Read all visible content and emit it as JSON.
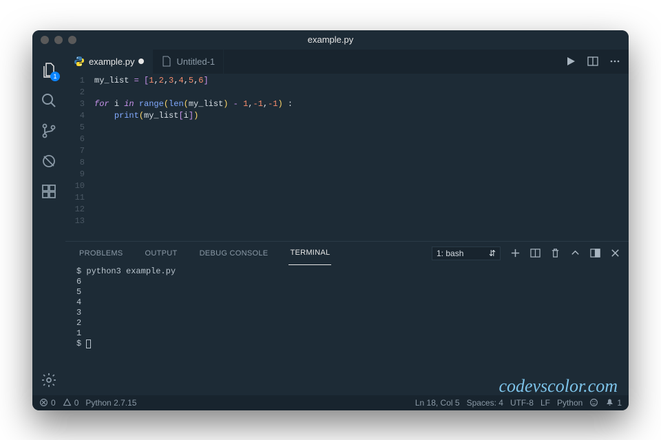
{
  "window": {
    "title": "example.py"
  },
  "activity": {
    "explorer_badge": "1"
  },
  "tabs": {
    "active": {
      "label": "example.py"
    },
    "second": {
      "label": "Untitled-1"
    }
  },
  "editor": {
    "lines": [
      "1",
      "2",
      "3",
      "4",
      "5",
      "6",
      "7",
      "8",
      "9",
      "10",
      "11",
      "12",
      "13"
    ],
    "l1_ident": "my_list",
    "l1_eq": " = ",
    "l1_ob": "[",
    "l1_n1": "1",
    "l1_c": ",",
    "l1_n2": "2",
    "l1_n3": "3",
    "l1_n4": "4",
    "l1_n5": "5",
    "l1_n6": "6",
    "l1_cb": "]",
    "l3_for": "for",
    "l3_sp": " ",
    "l3_i": "i",
    "l3_in": " in ",
    "l3_range": "range",
    "l3_open": "(",
    "l3_len": "len",
    "l3_o2": "(",
    "l3_ml": "my_list",
    "l3_c2": ")",
    "l3_sub": " - ",
    "l3_one": "1",
    "l3_co": ",",
    "l3_neg": "-1",
    "l3_close": ")",
    "l3_colon": " :",
    "l4_indent": "    ",
    "l4_print": "print",
    "l4_open": "(",
    "l4_ml": "my_list",
    "l4_ob": "[",
    "l4_i": "i",
    "l4_cb": "]",
    "l4_close": ")"
  },
  "panel": {
    "tabs": {
      "problems": "PROBLEMS",
      "output": "OUTPUT",
      "debug": "DEBUG CONSOLE",
      "terminal": "TERMINAL"
    },
    "term_select": "1: bash"
  },
  "terminal": {
    "line1": "$ python3 example.py",
    "out": [
      "6",
      "5",
      "4",
      "3",
      "2",
      "1"
    ],
    "prompt": "$ "
  },
  "watermark": "codevscolor.com",
  "status": {
    "errors": "0",
    "warnings": "0",
    "lang_left": "Python 2.7.15",
    "lncol": "Ln 18, Col 5",
    "spaces": "Spaces: 4",
    "encoding": "UTF-8",
    "eol": "LF",
    "lang": "Python",
    "notif": "1"
  }
}
